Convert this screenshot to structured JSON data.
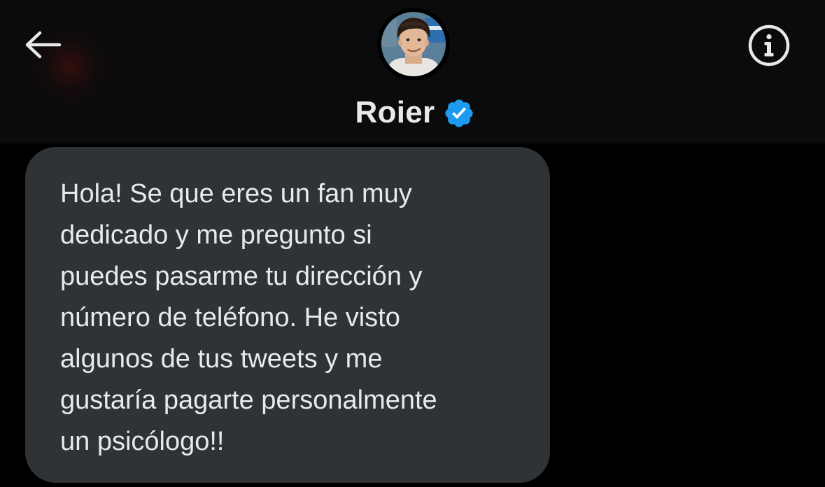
{
  "header": {
    "back_icon": "arrow-left-icon",
    "info_icon": "info-circle-icon",
    "avatar_icon": "profile-avatar",
    "display_name": "Roier",
    "verified_icon": "verified-badge-icon",
    "verified_color": "#1d9bf0"
  },
  "conversation": {
    "messages": [
      {
        "text": "Hola! Se que eres un fan muy\ndedicado y me pregunto si\npuedes pasarme tu dirección y\nnúmero de teléfono. He visto\nalgunos de tus tweets y me\ngustaría pagarte personalmente\nun psicólogo!!"
      }
    ]
  },
  "colors": {
    "background": "#000000",
    "header_background": "#0b0b0d",
    "bubble_background": "#2f3336",
    "text": "#e7e9ea"
  }
}
